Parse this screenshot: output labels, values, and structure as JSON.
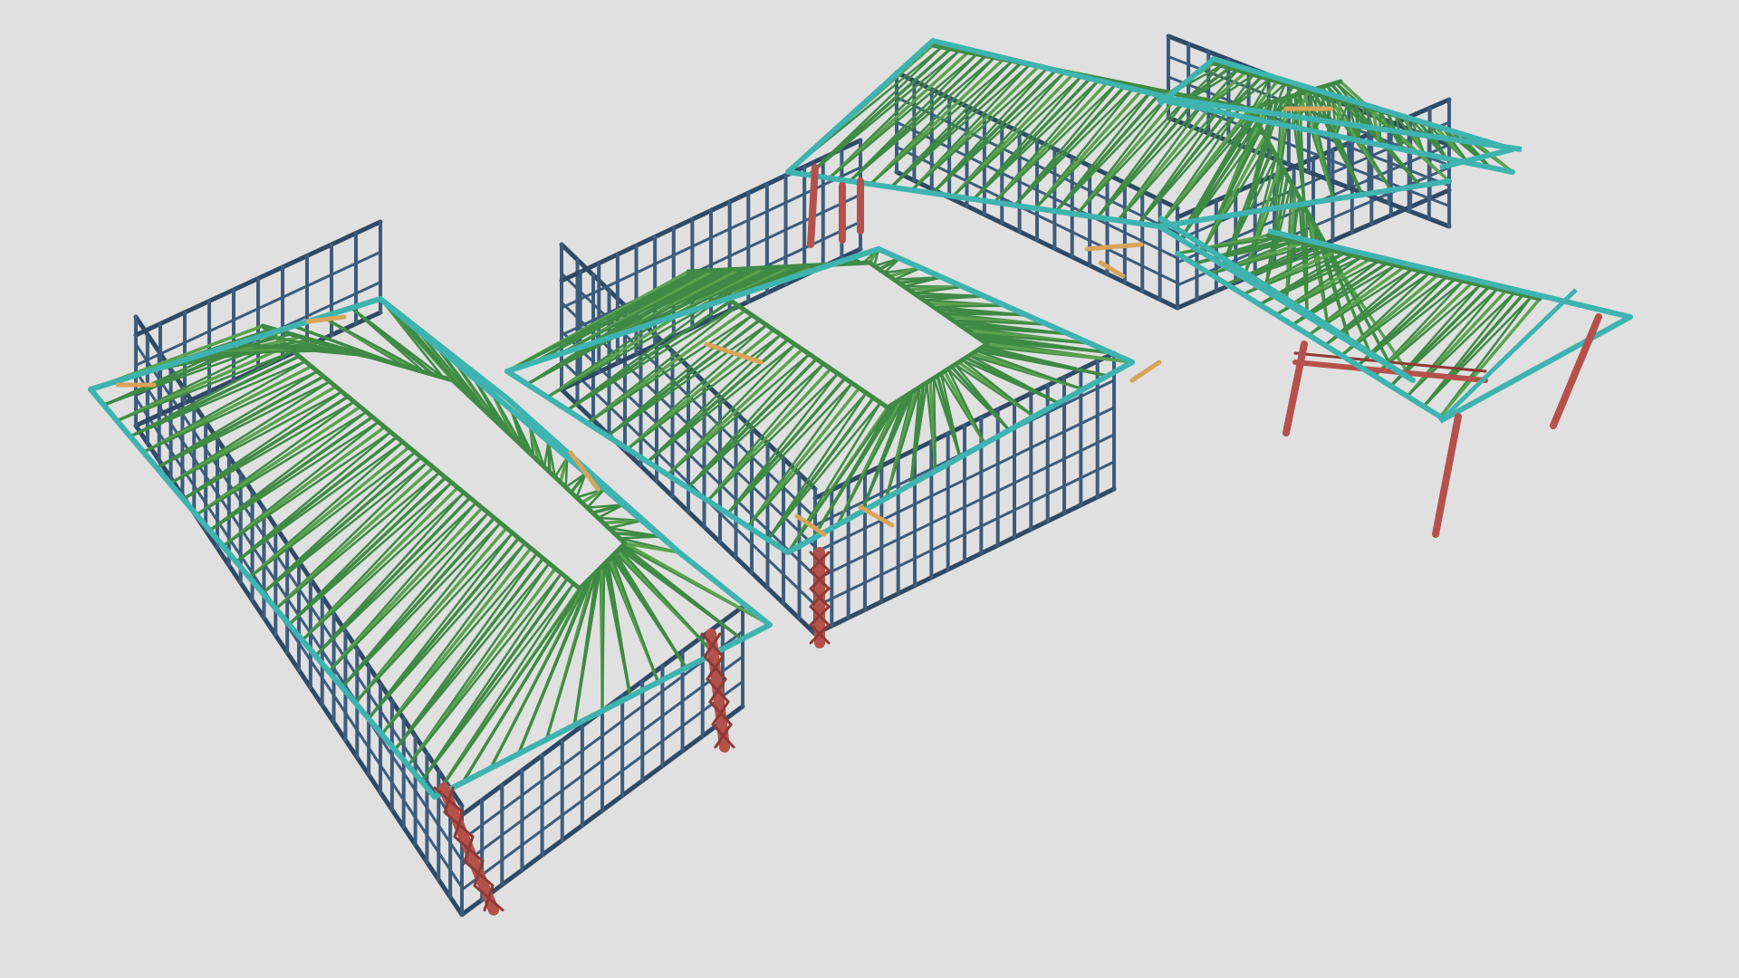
{
  "scene": {
    "background": "#e0e0e0",
    "palette": {
      "wall": "#3d5c7d",
      "wall_dark": "#2f4a66",
      "truss": "#3f8a45",
      "truss_light": "#5aa24e",
      "fascia": "#3fb3b0",
      "fascia_dark": "#2e8f8d",
      "post": "#b5514b",
      "post_dark": "#8e3a36",
      "timber": "#d9a45a"
    },
    "objects": {
      "wing_left": "steel-frame-wing-left",
      "wing_center": "steel-frame-wing-center",
      "wing_rear": "steel-frame-wing-rear",
      "wing_right": "steel-frame-wing-right",
      "posts": "steel-posts",
      "porch": "carport-frame"
    }
  }
}
